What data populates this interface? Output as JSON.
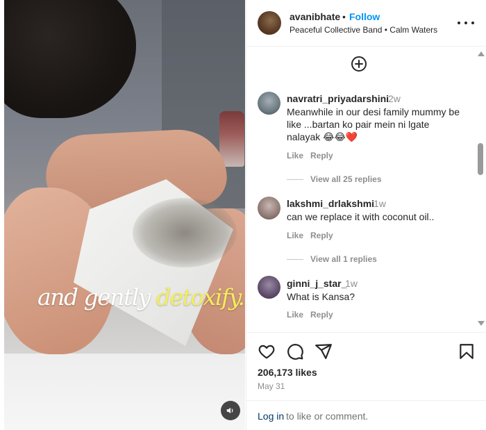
{
  "post": {
    "caption_normal": "and gently ",
    "caption_highlight": "detoxify."
  },
  "header": {
    "username": "avanibhate",
    "separator": "•",
    "follow_label": "Follow",
    "subtitle": "Peaceful Collective Band • Calm Waters"
  },
  "comments": [
    {
      "username": "navratri_priyadarshini",
      "time": "2w",
      "text": "Meanwhile in our desi family mummy be like ...bartan ko pair mein ni lgate nalayak 😂😂❤️",
      "like_label": "Like",
      "reply_label": "Reply",
      "view_replies": "View all 25 replies"
    },
    {
      "username": "lakshmi_drlakshmi",
      "time": "1w",
      "text": "can we replace it with coconut oil..",
      "like_label": "Like",
      "reply_label": "Reply",
      "view_replies": "View all 1 replies"
    },
    {
      "username": "ginni_j_star_",
      "time": "1w",
      "text": "What is Kansa?",
      "like_label": "Like",
      "reply_label": "Reply"
    }
  ],
  "engagement": {
    "likes": "206,173 likes",
    "date": "May 31"
  },
  "footer": {
    "login_link": "Log in",
    "login_rest": "to like or comment."
  },
  "icons": {
    "heart": "heart-icon",
    "comment": "comment-icon",
    "share": "share-icon",
    "save": "bookmark-icon",
    "mute": "speaker-icon",
    "add": "plus-circle-icon"
  },
  "colors": {
    "follow": "#0095f6",
    "caption_highlight": "#f3ee5a",
    "login_link": "#00376b"
  }
}
